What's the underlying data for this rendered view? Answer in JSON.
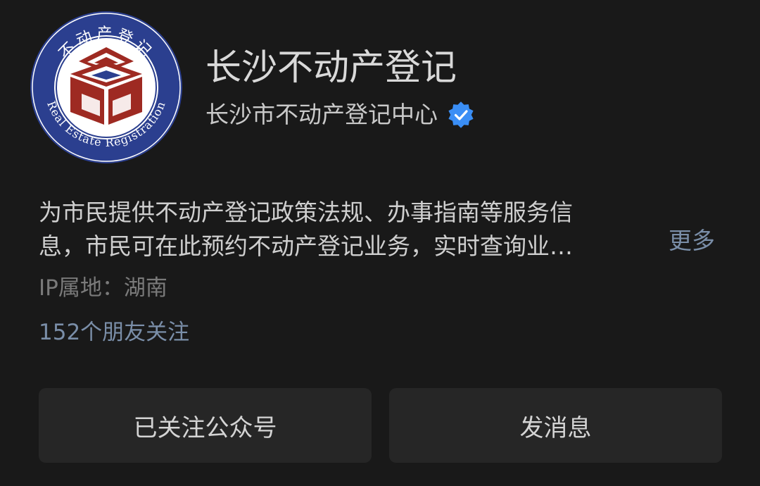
{
  "account": {
    "name": "长沙不动产登记",
    "owner": "长沙市不动产登记中心",
    "verified_icon": "verified-badge-icon",
    "verified_color": "#3a8ef5"
  },
  "logo": {
    "top_text": "不动产登记",
    "bottom_text": "Real Estate Registration",
    "ring_color": "#2b3f8f",
    "emblem_color": "#9e2a22"
  },
  "description": {
    "line1": "为市民提供不动产登记政策法规、办事指南等服务信",
    "line2": "息，市民可在此预约不动产登记业务，实时查询业…",
    "more_label": "更多"
  },
  "ip_location": "IP属地：湖南",
  "friends_following": "152个朋友关注",
  "actions": {
    "follow_label": "已关注公众号",
    "message_label": "发消息"
  },
  "colors": {
    "background": "#191919",
    "button_bg": "#262626",
    "link": "#7a8ea8"
  }
}
